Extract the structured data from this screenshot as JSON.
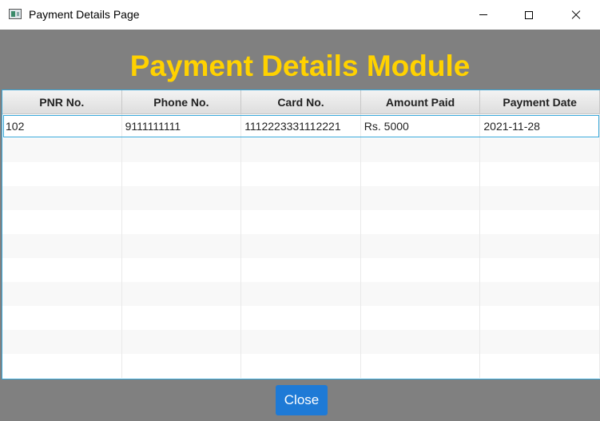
{
  "window": {
    "title": "Payment Details Page",
    "icon": "app-window-icon"
  },
  "header": {
    "title": "Payment Details Module",
    "color": "#ffd200"
  },
  "table": {
    "columns": [
      "PNR No.",
      "Phone No.",
      "Card No.",
      "Amount Paid",
      "Payment Date"
    ],
    "rows": [
      [
        "102",
        "9111111111",
        "1112223331112221",
        "Rs. 5000",
        "2021-11-28"
      ]
    ]
  },
  "footer": {
    "close_label": "Close"
  },
  "colors": {
    "background": "#808080",
    "accent": "#1e7ad6",
    "selection": "#38a7d8"
  }
}
